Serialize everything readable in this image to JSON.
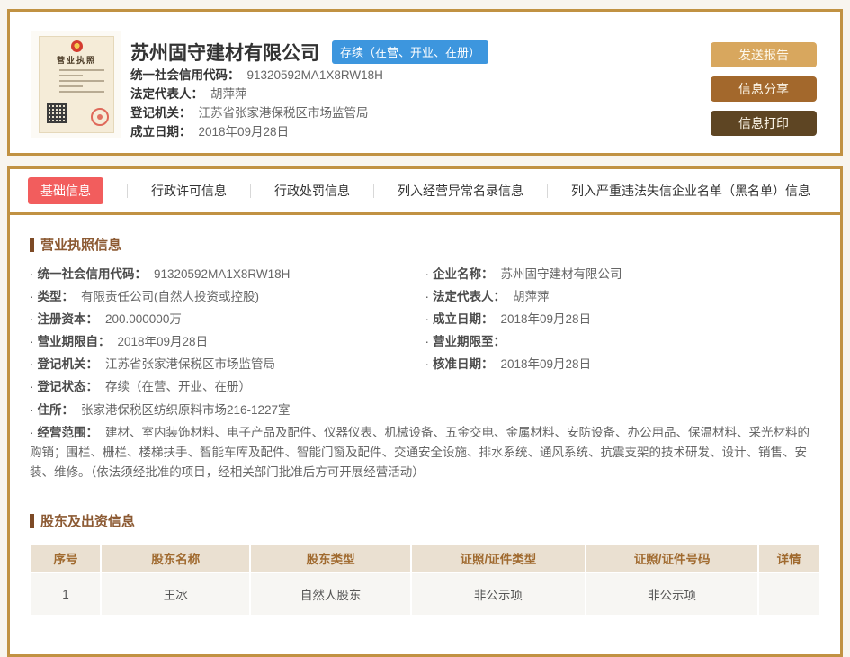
{
  "header": {
    "company_name": "苏州固守建材有限公司",
    "status_badge": "存续（在营、开业、在册）",
    "license_title": "营业执照",
    "fields": [
      {
        "label": "统一社会信用代码：",
        "value": "91320592MA1X8RW18H"
      },
      {
        "label": "法定代表人：",
        "value": "胡萍萍"
      },
      {
        "label": "登记机关：",
        "value": "江苏省张家港保税区市场监管局"
      },
      {
        "label": "成立日期：",
        "value": "2018年09月28日"
      }
    ],
    "buttons": [
      {
        "label": "发送报告"
      },
      {
        "label": "信息分享"
      },
      {
        "label": "信息打印"
      }
    ]
  },
  "tabs": [
    {
      "label": "基础信息",
      "active": true
    },
    {
      "label": "行政许可信息",
      "active": false
    },
    {
      "label": "行政处罚信息",
      "active": false
    },
    {
      "label": "列入经营异常名录信息",
      "active": false
    },
    {
      "label": "列入严重违法失信企业名单（黑名单）信息",
      "active": false
    }
  ],
  "license_section": {
    "title": "营业执照信息",
    "left_fields": [
      {
        "label": "统一社会信用代码：",
        "value": "91320592MA1X8RW18H"
      },
      {
        "label": "类型：",
        "value": "有限责任公司(自然人投资或控股)"
      },
      {
        "label": "注册资本：",
        "value": "200.000000万"
      },
      {
        "label": "营业期限自：",
        "value": "2018年09月28日"
      },
      {
        "label": "登记机关：",
        "value": "江苏省张家港保税区市场监管局"
      },
      {
        "label": "登记状态：",
        "value": "存续（在营、开业、在册）"
      }
    ],
    "right_fields": [
      {
        "label": "企业名称：",
        "value": "苏州固守建材有限公司"
      },
      {
        "label": "法定代表人：",
        "value": "胡萍萍"
      },
      {
        "label": "成立日期：",
        "value": "2018年09月28日"
      },
      {
        "label": "营业期限至：",
        "value": ""
      },
      {
        "label": "核准日期：",
        "value": "2018年09月28日"
      }
    ],
    "full_fields": [
      {
        "label": "住所：",
        "value": "张家港保税区纺织原料市场216-1227室"
      },
      {
        "label": "经营范围：",
        "value": "建材、室内装饰材料、电子产品及配件、仪器仪表、机械设备、五金交电、金属材料、安防设备、办公用品、保温材料、采光材料的购销；围栏、栅栏、楼梯扶手、智能车库及配件、智能门窗及配件、交通安全设施、排水系统、通风系统、抗震支架的技术研发、设计、销售、安装、维修。（依法须经批准的项目，经相关部门批准后方可开展经营活动）"
      }
    ]
  },
  "shareholder_section": {
    "title": "股东及出资信息",
    "table": {
      "headers": [
        "序号",
        "股东名称",
        "股东类型",
        "证照/证件类型",
        "证照/证件号码",
        "详情"
      ],
      "rows": [
        [
          "1",
          "王冰",
          "自然人股东",
          "非公示项",
          "非公示项",
          ""
        ]
      ]
    }
  },
  "colors": {
    "page_background": "#f8f5ef",
    "panel_border_gold": "#c19243",
    "active_tab_red": "#f25d5d",
    "status_badge_blue": "#3d96de",
    "button_send_report": "#d8a75e",
    "button_share": "#a3682c",
    "button_print": "#5e4523",
    "section_title_brown": "#8c5a33",
    "table_header_bg": "#eae0d1",
    "table_header_text": "#a06a2f",
    "table_row_bg": "#f7f6f3"
  }
}
